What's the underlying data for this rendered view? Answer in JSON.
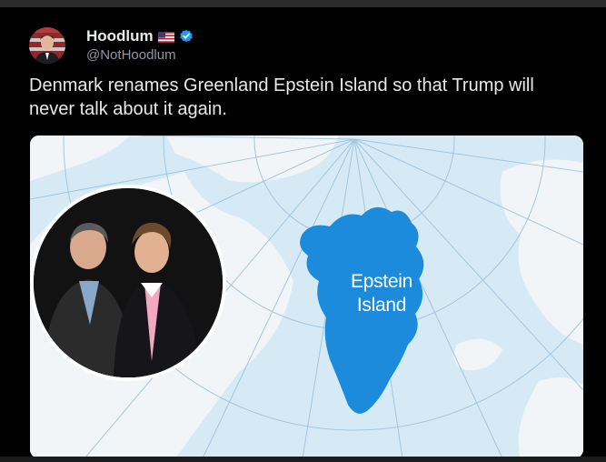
{
  "post": {
    "display_name": "Hoodlum",
    "handle": "@NotHoodlum",
    "text": "Denmark renames Greenland Epstein Island so that Trump will never talk about it again.",
    "flag_icon": "us-flag-icon",
    "verified_icon": "verified-badge-icon"
  },
  "media": {
    "map_label_line1": "Epstein",
    "map_label_line2": "Island",
    "colors": {
      "ocean": "#d6eaf6",
      "land": "#f2f5f7",
      "highlight": "#1d8bdb"
    }
  }
}
